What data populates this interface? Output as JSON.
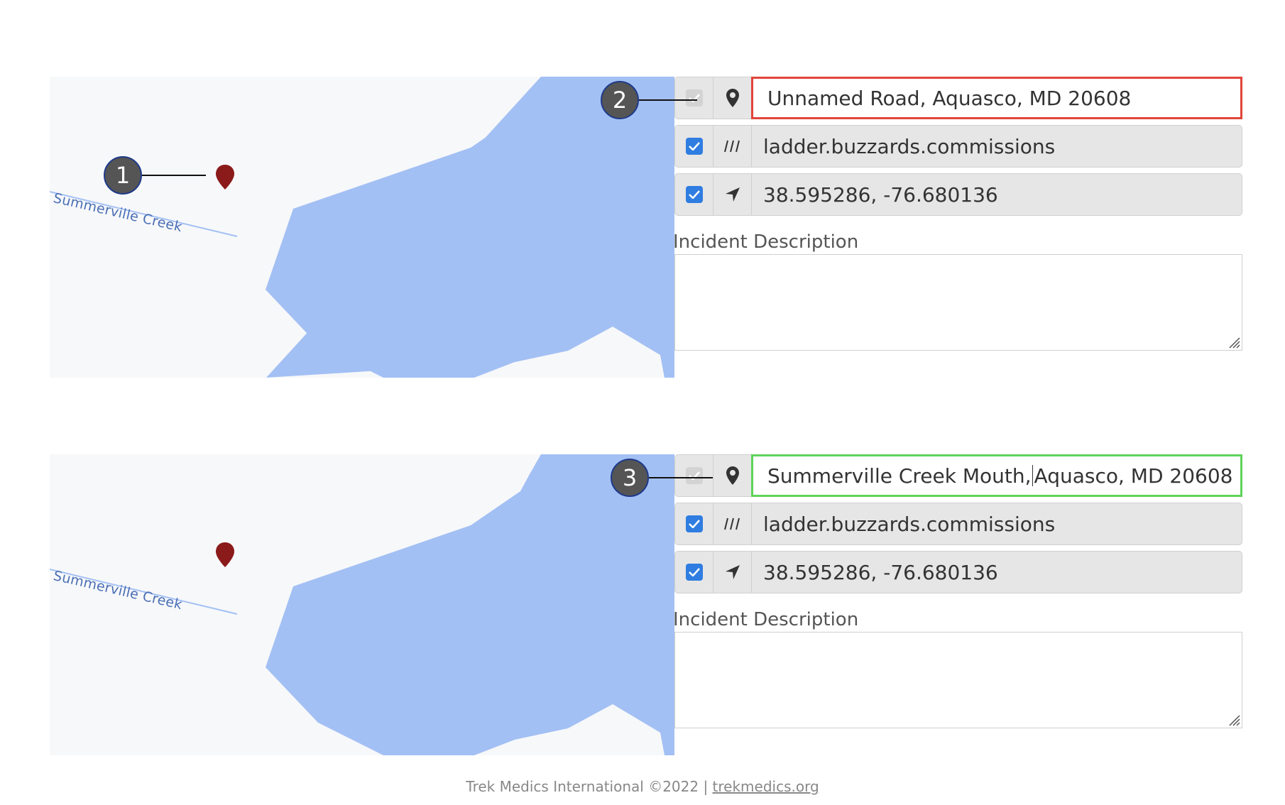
{
  "panel_top": {
    "map": {
      "creek_label": "Summerville Creek"
    },
    "address": "Unnamed Road, Aquasco, MD 20608",
    "what3words": "ladder.buzzards.commissions",
    "coordinates": "38.595286, -76.680136",
    "description_label": "Incident Description",
    "address_highlight": "#e0453a"
  },
  "panel_bottom": {
    "map": {
      "creek_label": "Summerville Creek"
    },
    "address_part1": "Summerville Creek Mouth,",
    "address_part2": "Aquasco, MD 20608",
    "what3words": "ladder.buzzards.commissions",
    "coordinates": "38.595286, -76.680136",
    "description_label": "Incident Description",
    "address_highlight": "#5ed35a"
  },
  "callouts": [
    "1",
    "2",
    "3"
  ],
  "icons": {
    "address": "map-pin-icon",
    "what3words": "slashes-icon",
    "coordinates": "navigation-arrow-icon",
    "map_marker": "map-marker-icon"
  },
  "colors": {
    "checkbox": "#2f7de1",
    "water": "#a3c0f4",
    "marker": "#8b1a1a"
  },
  "footer": {
    "text": "Trek Medics International ©2022 | ",
    "link": "trekmedics.org"
  }
}
